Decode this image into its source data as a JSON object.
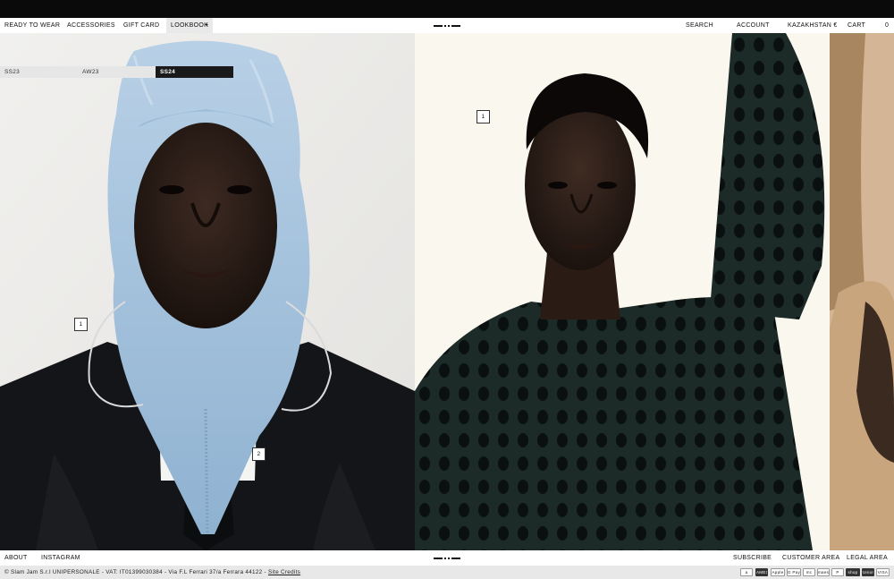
{
  "nav": {
    "left": [
      "READY TO WEAR",
      "ACCESSORIES",
      "GIFT CARD"
    ],
    "lookbook": "LOOKBOOK",
    "lookbook_marker": "•",
    "right": {
      "search": "SEARCH",
      "account": "ACCOUNT",
      "region": "KAZAKHSTAN €",
      "cart": "CART",
      "cart_count": "0"
    }
  },
  "subnav": {
    "items": [
      "SS23",
      "AW23",
      "SS24"
    ],
    "active": "SS24"
  },
  "gallery": {
    "panels": [
      {
        "hotspots": [
          "1",
          "2"
        ],
        "bg": "#ecebe8",
        "accent": "#9fc0dc"
      },
      {
        "hotspots": [
          "1"
        ],
        "bg": "#faf8ee",
        "accent": "#1f2e2b"
      },
      {
        "hotspots": [],
        "bg": "#caa986",
        "accent": "#3b2a20"
      }
    ]
  },
  "footer": {
    "left": [
      "ABOUT",
      "INSTAGRAM"
    ],
    "right": [
      "SUBSCRIBE",
      "CUSTOMER AREA",
      "LEGAL AREA"
    ]
  },
  "legal": {
    "text": "© Slam Jam S.r.l UNIPERSONALE - VAT: IT01399030384 - Via F.L Ferrari 37/a Ferrara 44122 -",
    "credits": "Site Credits"
  },
  "payments": [
    "a",
    "AMEX",
    "Apple Pay",
    "G Pay",
    "mc",
    "maestro",
    "P",
    "shop",
    "UnionPay",
    "VISA"
  ]
}
